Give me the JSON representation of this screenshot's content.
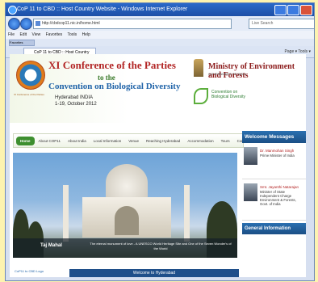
{
  "browser": {
    "title": "CoP 11 to CBD :: Host Country Website - Windows Internet Explorer",
    "address": "http://cbdcop11.nic.in/home.html",
    "search_placeholder": "Live Search",
    "menu": [
      "File",
      "Edit",
      "View",
      "Favorites",
      "Tools",
      "Help"
    ],
    "favorites_label": "Favorites",
    "tab_title": "CoP 11 to CBD :: Host Country Website",
    "tab_tools": "Page ▾  Tools ▾"
  },
  "site": {
    "conf_title": "XI Conference of the Parties",
    "to_the": "to the",
    "convention": "Convention on Biological Diversity",
    "location": "Hyderabad INDIA",
    "dates": "1-19, October 2012",
    "logo_caption": "XI Conference of the Parties",
    "ministry": "Ministry of Environment and Forests",
    "govt": "GOVERNMENT OF INDIA",
    "cbd_brand": "Convention on Biological Diversity"
  },
  "nav": [
    "Home",
    "About COP11",
    "About India",
    "Local Information",
    "Venue",
    "Reaching Hyderabad",
    "Accommodation",
    "Tours",
    "Contact Us"
  ],
  "hero": {
    "place": "Taj Mahal",
    "desc": "The eternal monument of love - A UNESCO World Heritage Site and One of the Seven Wonder's of the World"
  },
  "sidebar": {
    "welcome_title": "Welcome Messages",
    "people": [
      {
        "name": "Dr. Manmohan Singh",
        "role": "Prime Minister of India"
      },
      {
        "name": "Smt. Jayanthi Natarajan",
        "role": "Minister of State Independent Charge Environment & Forests, Govt. of India"
      }
    ],
    "general_title": "General Information"
  },
  "footer": {
    "logo_link": "CoP11 to CBD Logo",
    "welcome": "Welcome to Hyderabad"
  }
}
